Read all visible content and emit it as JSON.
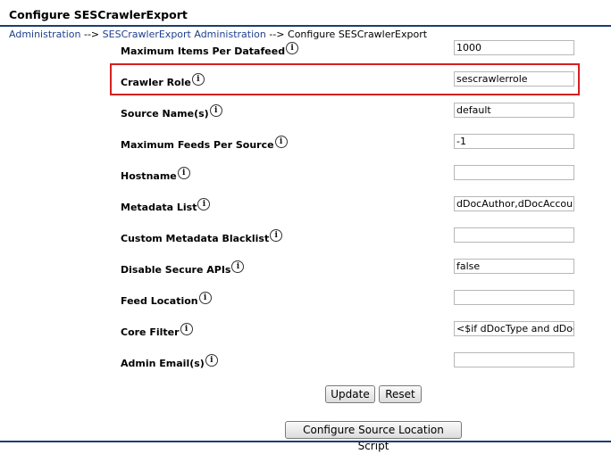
{
  "page": {
    "title": "Configure SESCrawlerExport"
  },
  "breadcrumb": {
    "link_1": "Administration",
    "sep_1": " --> ",
    "link_2": "SESCrawlerExport Administration",
    "sep_2": " --> ",
    "current": "Configure SESCrawlerExport"
  },
  "info_icon": {
    "glyph": "i",
    "icon": "info-icon"
  },
  "fields": [
    {
      "label": "Maximum Items Per Datafeed",
      "value": "1000"
    },
    {
      "label": "Crawler Role",
      "value": "sescrawlerrole"
    },
    {
      "label": "Source Name(s)",
      "value": "default"
    },
    {
      "label": "Maximum Feeds Per Source",
      "value": "-1"
    },
    {
      "label": "Hostname",
      "value": ""
    },
    {
      "label": "Metadata List",
      "value": "dDocAuthor,dDocAccount"
    },
    {
      "label": "Custom Metadata Blacklist",
      "value": ""
    },
    {
      "label": "Disable Secure APIs",
      "value": "false"
    },
    {
      "label": "Feed Location",
      "value": ""
    },
    {
      "label": "Core Filter",
      "value": "<$if dDocType and dDocType"
    },
    {
      "label": "Admin Email(s)",
      "value": ""
    }
  ],
  "buttons": {
    "update": "Update",
    "reset": "Reset",
    "configure_script": "Configure Source Location Script"
  },
  "colors": {
    "highlight": "#d42020",
    "link": "#1f3f8f",
    "rule": "#1d3e6e"
  }
}
